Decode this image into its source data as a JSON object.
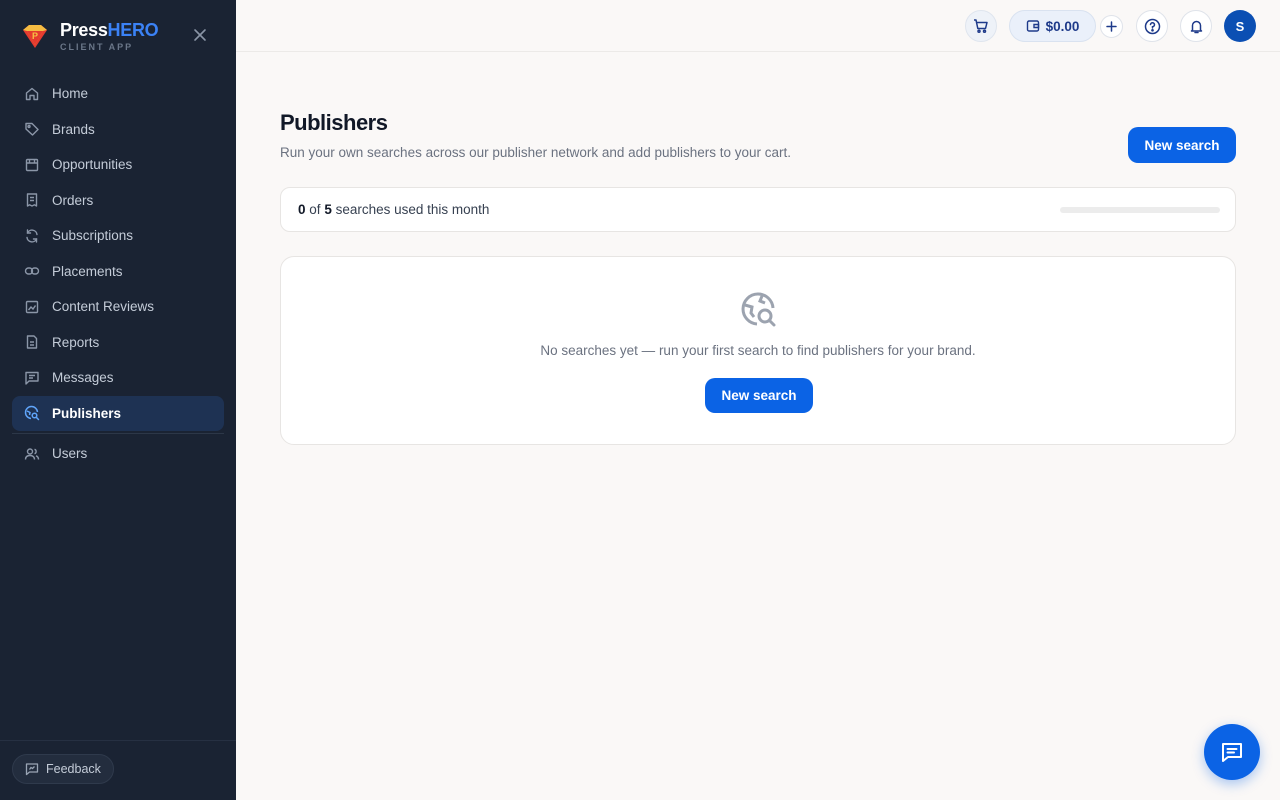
{
  "brand": {
    "name_part1": "Press",
    "name_part2": "HERO",
    "subtitle": "CLIENT APP"
  },
  "sidebar": {
    "items": [
      {
        "label": "Home",
        "icon": "home-icon"
      },
      {
        "label": "Brands",
        "icon": "tag-icon"
      },
      {
        "label": "Opportunities",
        "icon": "storefront-icon"
      },
      {
        "label": "Orders",
        "icon": "receipt-icon"
      },
      {
        "label": "Subscriptions",
        "icon": "refresh-icon"
      },
      {
        "label": "Placements",
        "icon": "link-icon"
      },
      {
        "label": "Content Reviews",
        "icon": "image-review-icon"
      },
      {
        "label": "Reports",
        "icon": "document-icon"
      },
      {
        "label": "Messages",
        "icon": "message-icon"
      },
      {
        "label": "Publishers",
        "icon": "globe-search-icon",
        "active": true
      },
      {
        "label": "Users",
        "icon": "users-icon"
      }
    ],
    "feedback_label": "Feedback"
  },
  "topbar": {
    "wallet_amount": "$0.00",
    "avatar_initial": "S"
  },
  "page": {
    "title": "Publishers",
    "subtitle": "Run your own searches across our publisher network and add publishers to your cart.",
    "new_search_label": "New search"
  },
  "usage": {
    "used": "0",
    "of_word": "of",
    "limit": "5",
    "suffix": "searches used this month",
    "progress_fraction": 0
  },
  "empty_state": {
    "message": "No searches yet — run your first search to find publishers for your brand.",
    "button_label": "New search"
  },
  "colors": {
    "sidebar_bg": "#1a2333",
    "accent": "#0b63e5",
    "brand_hero": "#3b82f6"
  }
}
